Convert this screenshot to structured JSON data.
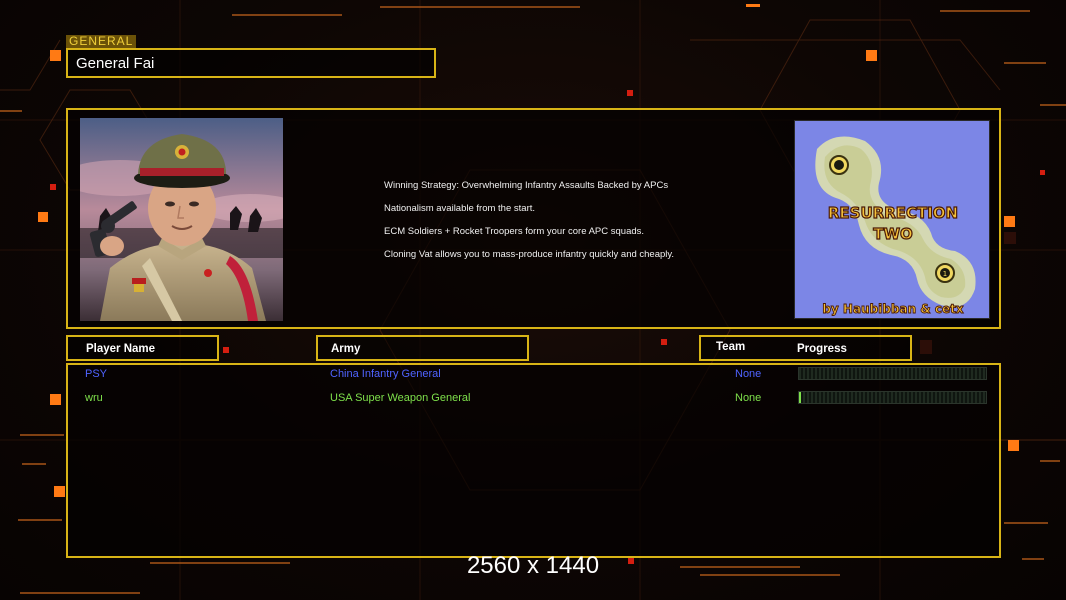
{
  "screen": {
    "section_tag": "GENERAL",
    "general_name": "General Fai",
    "resolution_text": "2560 x 1440"
  },
  "general_info": {
    "portrait_icon": "general-portrait",
    "description_lines": [
      "Winning Strategy: Overwhelming Infantry Assaults Backed by APCs",
      "Nationalism available from the start.",
      "ECM Soldiers + Rocket Troopers form your core APC squads.",
      "Cloning Vat allows you to mass-produce infantry quickly and cheaply."
    ]
  },
  "map_preview": {
    "title_line1": "RESURRECTION",
    "title_line2": "TWO",
    "credit": "by Haubibban & cetx",
    "start_markers": [
      "",
      "1"
    ],
    "colors": {
      "water": "#7c86e6",
      "land": "#d9dcb0",
      "title": "#f5c23a"
    }
  },
  "columns": {
    "player_name": "Player Name",
    "army": "Army",
    "team": "Team",
    "progress": "Progress"
  },
  "players": [
    {
      "name": "PSY",
      "army": "China Infantry General",
      "team": "None",
      "progress": 0.0,
      "color": "#4f63ff"
    },
    {
      "name": "wru",
      "army": "USA Super Weapon General",
      "team": "None",
      "progress": 0.01,
      "color": "#7ee04b"
    }
  ],
  "theme": {
    "accent": "#d8b416",
    "background": "#0b0604",
    "glow_orange": "#ff7a14"
  }
}
